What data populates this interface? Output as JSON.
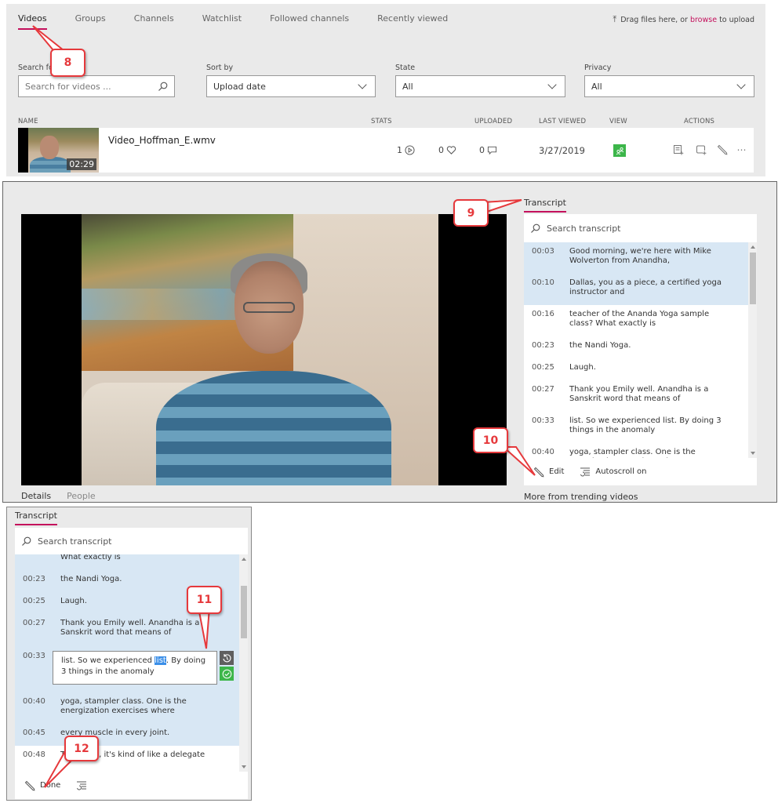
{
  "library": {
    "tabs": [
      {
        "label": "Videos",
        "active": true
      },
      {
        "label": "Groups",
        "active": false
      },
      {
        "label": "Channels",
        "active": false
      },
      {
        "label": "Watchlist",
        "active": false
      },
      {
        "label": "Followed channels",
        "active": false
      },
      {
        "label": "Recently viewed",
        "active": false
      }
    ],
    "upload": {
      "icon": "upload-icon",
      "prefix": "Drag files here, or ",
      "link": "browse",
      "suffix": " to upload"
    },
    "filters": {
      "search": {
        "label": "Search for videos",
        "placeholder": "Search for videos ..."
      },
      "sort": {
        "label": "Sort by",
        "value": "Upload date"
      },
      "state": {
        "label": "State",
        "value": "All"
      },
      "privacy": {
        "label": "Privacy",
        "value": "All"
      }
    },
    "columns": {
      "name": "NAME",
      "stats": "STATS",
      "uploaded": "UPLOADED",
      "last_viewed": "LAST VIEWED",
      "view": "VIEW",
      "actions": "ACTIONS"
    },
    "videos": [
      {
        "name": "Video_Hoffman_E.wmv",
        "duration": "02:29",
        "views": "1",
        "likes": "0",
        "comments": "0",
        "last_viewed": "3/27/2019",
        "view_status_color": "#3cb64a"
      }
    ]
  },
  "player": {
    "tabs": [
      {
        "label": "Details",
        "active": true
      },
      {
        "label": "People",
        "active": false
      }
    ],
    "more_label": "More from trending videos"
  },
  "transcript": {
    "title": "Transcript",
    "search_placeholder": "Search transcript",
    "edit_label": "Edit",
    "autoscroll_label": "Autoscroll on",
    "items": [
      {
        "time": "00:03",
        "text": "Good morning, we're here with Mike Wolverton from Anandha,",
        "highlighted": true
      },
      {
        "time": "00:10",
        "text": "Dallas, you as a piece, a certified yoga instructor and",
        "highlighted": true
      },
      {
        "time": "00:16",
        "text": "teacher of the Ananda Yoga sample class? What exactly is",
        "highlighted": false
      },
      {
        "time": "00:23",
        "text": "the Nandi Yoga.",
        "highlighted": false
      },
      {
        "time": "00:25",
        "text": "Laugh.",
        "highlighted": false
      },
      {
        "time": "00:27",
        "text": "Thank you Emily well. Anandha is a Sanskrit word that means of",
        "highlighted": false
      },
      {
        "time": "00:33",
        "text": "list. So we experienced list. By doing 3 things in the anomaly",
        "highlighted": false
      },
      {
        "time": "00:40",
        "text": "yoga, stampler class. One is the energization exercises where",
        "highlighted": false
      }
    ]
  },
  "transcript_edit": {
    "title": "Transcript",
    "search_placeholder": "Search transcript",
    "partial_top": "What exactly is",
    "done_label": "Done",
    "items": [
      {
        "time": "00:23",
        "text": "the Nandi Yoga.",
        "highlighted": true
      },
      {
        "time": "00:25",
        "text": "Laugh.",
        "highlighted": true
      },
      {
        "time": "00:27",
        "text": "Thank you Emily well. Anandha is a Sanskrit word that means of",
        "highlighted": true
      }
    ],
    "editing": {
      "time": "00:33",
      "before": "list. So we experienced ",
      "selected": "list",
      "after": ". By doing 3 things in the anomaly",
      "revert_icon": "revert-icon",
      "confirm_icon": "checkmark-icon",
      "confirm_color": "#3cb64a"
    },
    "items_after": [
      {
        "time": "00:40",
        "text": "yoga, stampler class. One is the energization exercises where",
        "highlighted": true
      },
      {
        "time": "00:45",
        "text": "every muscle in every joint.",
        "highlighted": true
      },
      {
        "time": "00:48",
        "text": "The value, it's kind of like a delegate",
        "highlighted": false
      }
    ]
  },
  "callouts": [
    "8",
    "9",
    "10",
    "11",
    "12"
  ],
  "colors": {
    "accent": "#c4105c",
    "callout": "#e6393c",
    "highlight": "#d8e7f4",
    "success": "#3cb64a"
  }
}
